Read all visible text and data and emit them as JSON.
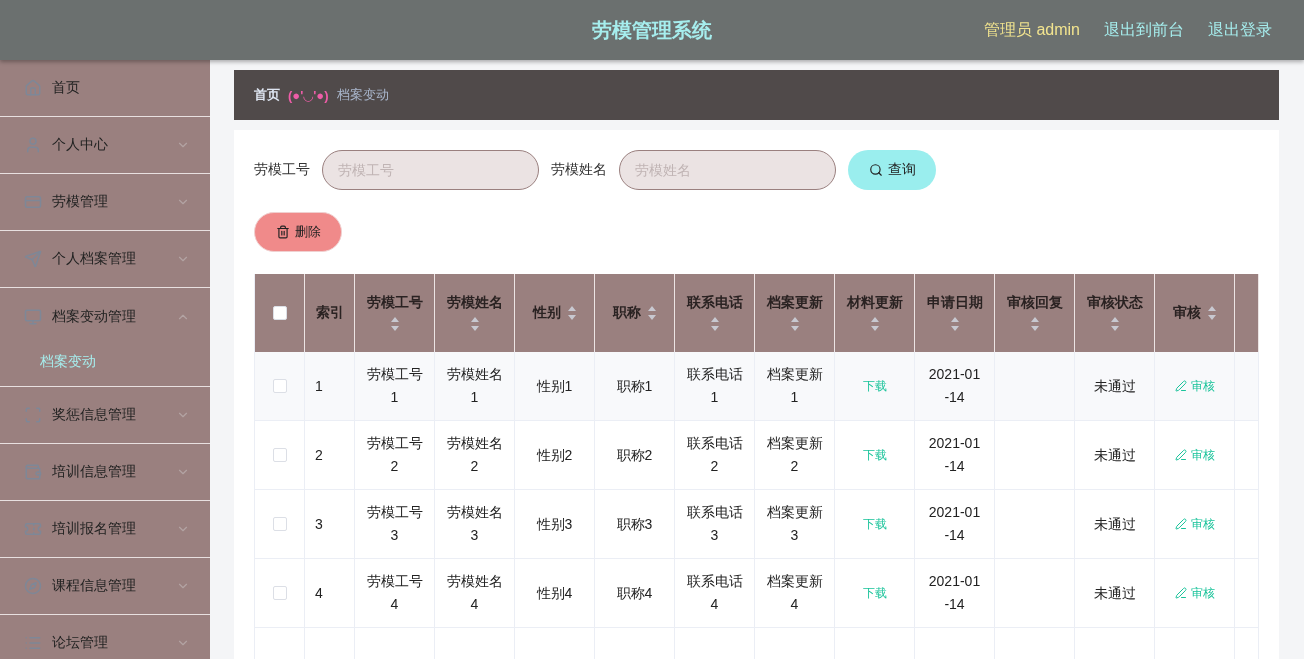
{
  "header": {
    "title": "劳模管理系统",
    "user": "管理员 admin",
    "links": [
      "退出到前台",
      "退出登录"
    ]
  },
  "sidebar": {
    "items": [
      {
        "label": "首页",
        "expanded": false,
        "has_children": false
      },
      {
        "label": "个人中心",
        "expanded": false,
        "has_children": true
      },
      {
        "label": "劳模管理",
        "expanded": false,
        "has_children": true
      },
      {
        "label": "个人档案管理",
        "expanded": false,
        "has_children": true
      },
      {
        "label": "档案变动管理",
        "expanded": true,
        "has_children": true,
        "children": [
          {
            "label": "档案变动",
            "selected": true
          }
        ]
      },
      {
        "label": "奖惩信息管理",
        "expanded": false,
        "has_children": true
      },
      {
        "label": "培训信息管理",
        "expanded": false,
        "has_children": true
      },
      {
        "label": "培训报名管理",
        "expanded": false,
        "has_children": true
      },
      {
        "label": "课程信息管理",
        "expanded": false,
        "has_children": true
      },
      {
        "label": "论坛管理",
        "expanded": false,
        "has_children": true
      }
    ]
  },
  "breadcrumb": {
    "home": "首页",
    "separator": "(●'◡'●)",
    "current": "档案变动"
  },
  "search": {
    "fields": [
      {
        "label": "劳模工号",
        "placeholder": "劳模工号"
      },
      {
        "label": "劳模姓名",
        "placeholder": "劳模姓名"
      }
    ],
    "button": "查询"
  },
  "delete_button": "删除",
  "table": {
    "select_all_checked": false,
    "columns": [
      {
        "label": "索引",
        "sortable": false
      },
      {
        "label": "劳模工号",
        "sortable": true
      },
      {
        "label": "劳模姓名",
        "sortable": true
      },
      {
        "label": "性别",
        "sortable": true
      },
      {
        "label": "职称",
        "sortable": true
      },
      {
        "label": "联系电话",
        "sortable": true
      },
      {
        "label": "档案更新",
        "sortable": true
      },
      {
        "label": "材料更新",
        "sortable": true
      },
      {
        "label": "申请日期",
        "sortable": true
      },
      {
        "label": "审核回复",
        "sortable": true
      },
      {
        "label": "审核状态",
        "sortable": true
      },
      {
        "label": "审核",
        "sortable": true
      }
    ],
    "rows": [
      {
        "checked": false,
        "cells": [
          "1",
          "劳模工号1",
          "劳模姓名1",
          "性别1",
          "职称1",
          "联系电话1",
          "档案更新1",
          "下载",
          "2021-01-14",
          "",
          "未通过",
          "审核"
        ]
      },
      {
        "checked": false,
        "cells": [
          "2",
          "劳模工号2",
          "劳模姓名2",
          "性别2",
          "职称2",
          "联系电话2",
          "档案更新2",
          "下载",
          "2021-01-14",
          "",
          "未通过",
          "审核"
        ]
      },
      {
        "checked": false,
        "cells": [
          "3",
          "劳模工号3",
          "劳模姓名3",
          "性别3",
          "职称3",
          "联系电话3",
          "档案更新3",
          "下载",
          "2021-01-14",
          "",
          "未通过",
          "审核"
        ]
      },
      {
        "checked": false,
        "cells": [
          "4",
          "劳模工号4",
          "劳模姓名4",
          "性别4",
          "职称4",
          "联系电话4",
          "档案更新4",
          "下载",
          "2021-01-14",
          "",
          "未通过",
          "审核"
        ]
      }
    ]
  }
}
